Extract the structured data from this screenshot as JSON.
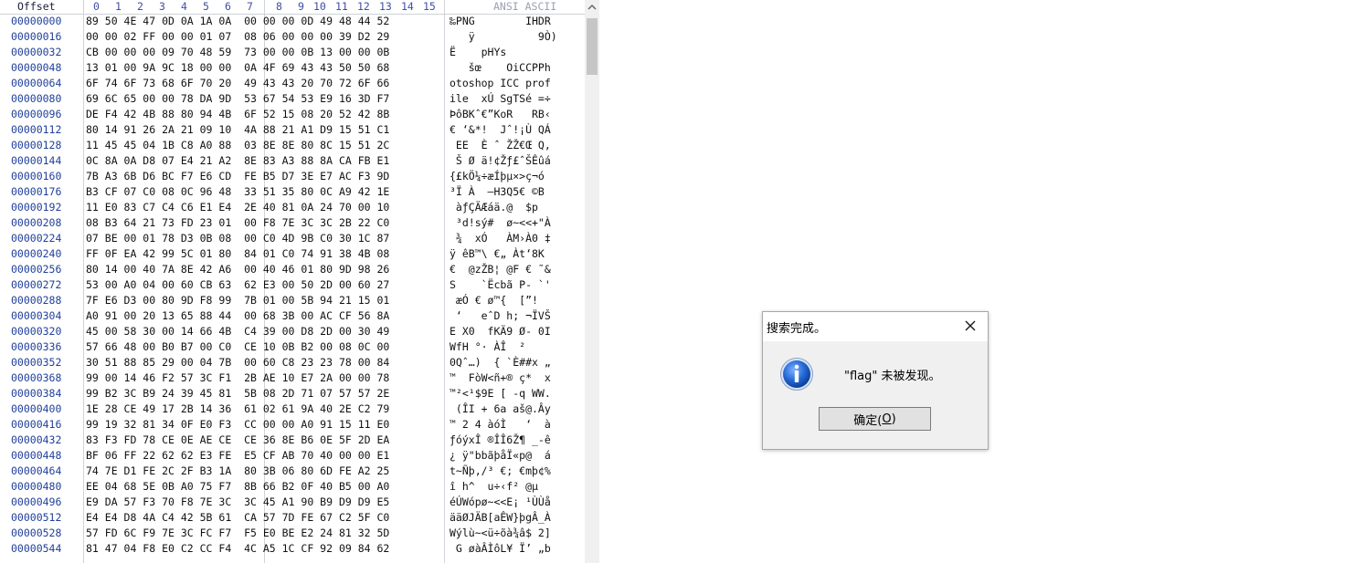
{
  "hex_view": {
    "header": {
      "offset": "Offset",
      "columns": [
        "0",
        "1",
        "2",
        "3",
        "4",
        "5",
        "6",
        "7",
        "8",
        "9",
        "10",
        "11",
        "12",
        "13",
        "14",
        "15"
      ],
      "ansi": "ANSI ASCII"
    },
    "rows": [
      {
        "offset": "00000000",
        "hex": "89 50 4E 47 0D 0A 1A 0A  00 00 00 0D 49 48 44 52",
        "ascii": "‰PNG        IHDR"
      },
      {
        "offset": "00000016",
        "hex": "00 00 02 FF 00 00 01 07  08 06 00 00 00 39 D2 29",
        "ascii": "   ÿ          9Ò)"
      },
      {
        "offset": "00000032",
        "hex": "CB 00 00 00 09 70 48 59  73 00 00 0B 13 00 00 0B",
        "ascii": "Ë    pHYs"
      },
      {
        "offset": "00000048",
        "hex": "13 01 00 9A 9C 18 00 00  0A 4F 69 43 43 50 50 68",
        "ascii": "   šœ    OiCCPPh"
      },
      {
        "offset": "00000064",
        "hex": "6F 74 6F 73 68 6F 70 20  49 43 43 20 70 72 6F 66",
        "ascii": "otoshop ICC prof"
      },
      {
        "offset": "00000080",
        "hex": "69 6C 65 00 00 78 DA 9D  53 67 54 53 E9 16 3D F7",
        "ascii": "ile  xÚ SgTSé =÷"
      },
      {
        "offset": "00000096",
        "hex": "DE F4 42 4B 88 80 94 4B  6F 52 15 08 20 52 42 8B",
        "ascii": "ÞôBKˆ€”KoR   RB‹"
      },
      {
        "offset": "00000112",
        "hex": "80 14 91 26 2A 21 09 10  4A 88 21 A1 D9 15 51 C1",
        "ascii": "€ ‘&*!  Jˆ!¡Ù QÁ"
      },
      {
        "offset": "00000128",
        "hex": "11 45 45 04 1B C8 A0 88  03 8E 8E 80 8C 15 51 2C",
        "ascii": " EE  È ˆ ŽŽ€Œ Q,"
      },
      {
        "offset": "00000144",
        "hex": "0C 8A 0A D8 07 E4 21 A2  8E 83 A3 88 8A CA FB E1",
        "ascii": " Š Ø ä!¢Žƒ£ˆŠÊûá"
      },
      {
        "offset": "00000160",
        "hex": "7B A3 6B D6 BC F7 E6 CD  FE B5 D7 3E E7 AC F3 9D",
        "ascii": "{£kÖ¼÷æÍþµ×>ç¬ó"
      },
      {
        "offset": "00000176",
        "hex": "B3 CF 07 C0 08 0C 96 48  33 51 35 80 0C A9 42 1E",
        "ascii": "³Ï À  –H3Q5€ ©B"
      },
      {
        "offset": "00000192",
        "hex": "11 E0 83 C7 C4 C6 E1 E4  2E 40 81 0A 24 70 00 10",
        "ascii": " àƒÇÄÆáä.@  $p"
      },
      {
        "offset": "00000208",
        "hex": "08 B3 64 21 73 FD 23 01  00 F8 7E 3C 3C 2B 22 C0",
        "ascii": " ³d!sý#  ø~<<+\"À"
      },
      {
        "offset": "00000224",
        "hex": "07 BE 00 01 78 D3 0B 08  00 C0 4D 9B C0 30 1C 87",
        "ascii": " ¾  xÓ   ÀM›À0 ‡"
      },
      {
        "offset": "00000240",
        "hex": "FF 0F EA 42 99 5C 01 80  84 01 C0 74 91 38 4B 08",
        "ascii": "ÿ êB™\\ €„ Àt‘8K"
      },
      {
        "offset": "00000256",
        "hex": "80 14 00 40 7A 8E 42 A6  00 40 46 01 80 9D 98 26",
        "ascii": "€  @zŽB¦ @F € ˜&"
      },
      {
        "offset": "00000272",
        "hex": "53 00 A0 04 00 60 CB 63  62 E3 00 50 2D 00 60 27",
        "ascii": "S    `Ëcbã P- `'"
      },
      {
        "offset": "00000288",
        "hex": "7F E6 D3 00 80 9D F8 99  7B 01 00 5B 94 21 15 01",
        "ascii": " æÓ € ø™{  [”!"
      },
      {
        "offset": "00000304",
        "hex": "A0 91 00 20 13 65 88 44  00 68 3B 00 AC CF 56 8A",
        "ascii": " ‘   eˆD h; ¬ÏVŠ"
      },
      {
        "offset": "00000320",
        "hex": "45 00 58 30 00 14 66 4B  C4 39 00 D8 2D 00 30 49",
        "ascii": "E X0  fKÄ9 Ø- 0I"
      },
      {
        "offset": "00000336",
        "hex": "57 66 48 00 B0 B7 00 C0  CE 10 0B B2 00 08 0C 00",
        "ascii": "WfH °· ÀÎ  ²"
      },
      {
        "offset": "00000352",
        "hex": "30 51 88 85 29 00 04 7B  00 60 C8 23 23 78 00 84",
        "ascii": "0Qˆ…)  { `È##x „"
      },
      {
        "offset": "00000368",
        "hex": "99 00 14 46 F2 57 3C F1  2B AE 10 E7 2A 00 00 78",
        "ascii": "™  FòW<ñ+® ç*  x"
      },
      {
        "offset": "00000384",
        "hex": "99 B2 3C B9 24 39 45 81  5B 08 2D 71 07 57 57 2E",
        "ascii": "™²<¹$9E [ -q WW."
      },
      {
        "offset": "00000400",
        "hex": "1E 28 CE 49 17 2B 14 36  61 02 61 9A 40 2E C2 79",
        "ascii": " (ÎI + 6a aš@.Ây"
      },
      {
        "offset": "00000416",
        "hex": "99 19 32 81 34 0F E0 F3  CC 00 00 A0 91 15 11 E0",
        "ascii": "™ 2 4 àóÌ   ‘  à"
      },
      {
        "offset": "00000432",
        "hex": "83 F3 FD 78 CE 0E AE CE  CE 36 8E B6 0E 5F 2D EA",
        "ascii": "ƒóýxÎ ®ÎÎ6Ž¶ _-ê"
      },
      {
        "offset": "00000448",
        "hex": "BF 06 FF 22 62 62 E3 FE  E5 CF AB 70 40 00 00 E1",
        "ascii": "¿ ÿ\"bbãþåÏ«p@  á"
      },
      {
        "offset": "00000464",
        "hex": "74 7E D1 FE 2C 2F B3 1A  80 3B 06 80 6D FE A2 25",
        "ascii": "t~Ñþ,/³ €; €mþ¢%"
      },
      {
        "offset": "00000480",
        "hex": "EE 04 68 5E 0B A0 75 F7  8B 66 B2 0F 40 B5 00 A0",
        "ascii": "î h^  u÷‹f² @µ"
      },
      {
        "offset": "00000496",
        "hex": "E9 DA 57 F3 70 F8 7E 3C  3C 45 A1 90 B9 D9 D9 E5",
        "ascii": "éÚWópø~<<E¡ ¹ÙÙå"
      },
      {
        "offset": "00000512",
        "hex": "E4 E4 D8 4A C4 42 5B 61  CA 57 7D FE 67 C2 5F C0",
        "ascii": "ääØJÄB[aÊW}þgÂ_À"
      },
      {
        "offset": "00000528",
        "hex": "57 FD 6C F9 7E 3C FC F7  F5 E0 BE E2 24 81 32 5D",
        "ascii": "Wýlù~<ü÷õà¾â$ 2]"
      },
      {
        "offset": "00000544",
        "hex": "81 47 04 F8 E0 C2 CC F4  4C A5 1C CF 92 09 84 62",
        "ascii": " G øàÂÌôL¥ Ï’ „b"
      }
    ]
  },
  "dialog": {
    "title": "搜索完成。",
    "message": "\"flag\" 未被发现。",
    "ok_label": "确定(",
    "ok_hotkey": "O",
    "ok_suffix": ")",
    "icon": "information-icon",
    "close_icon": "close-icon"
  }
}
